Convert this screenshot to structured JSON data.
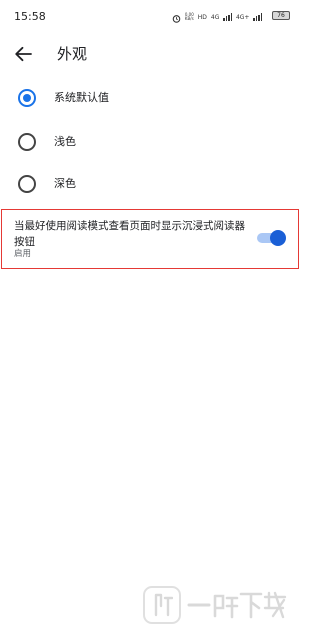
{
  "status_bar": {
    "time": "15:58",
    "net_speed_value": "0.00",
    "net_speed_unit": "KB/s",
    "hd_badge": "HD",
    "network_primary": "4G",
    "network_secondary": "4G+",
    "battery_level": "76"
  },
  "app_bar": {
    "title": "外观"
  },
  "theme_options": [
    {
      "label": "系统默认值",
      "selected": true
    },
    {
      "label": "浅色",
      "selected": false
    },
    {
      "label": "深色",
      "selected": false
    }
  ],
  "reader_mode": {
    "title": "当最好使用阅读模式查看页面时显示沉浸式阅读器按钮",
    "subtitle": "启用",
    "enabled": true
  },
  "colors": {
    "accent": "#1a73e8",
    "highlight_border": "#e53935"
  }
}
